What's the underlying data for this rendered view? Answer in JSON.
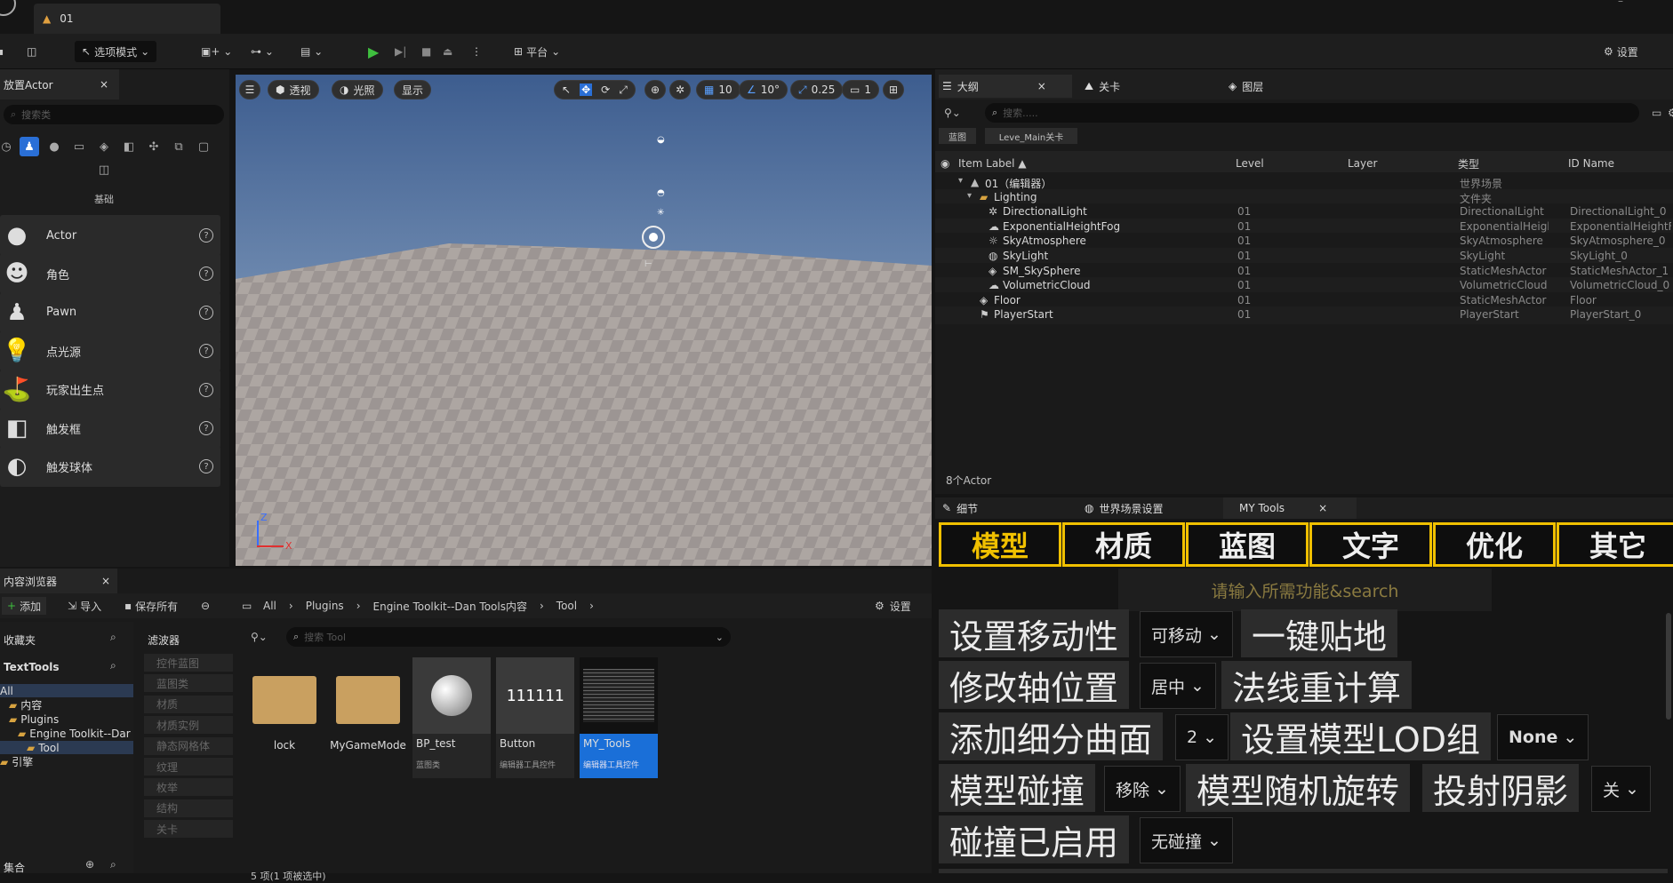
{
  "titlebar": {
    "doc_tab": "01"
  },
  "toolbar": {
    "mode": "选项模式",
    "platform": "平台",
    "settings": "设置"
  },
  "place_actor": {
    "tab": "放置Actor",
    "search_placeholder": "搜索类",
    "category": "基础",
    "items": [
      {
        "label": "Actor",
        "icon": "sphere-icon"
      },
      {
        "label": "角色",
        "icon": "character-icon"
      },
      {
        "label": "Pawn",
        "icon": "pawn-icon"
      },
      {
        "label": "点光源",
        "icon": "point-light-icon"
      },
      {
        "label": "玩家出生点",
        "icon": "player-start-icon"
      },
      {
        "label": "触发框",
        "icon": "trigger-box-icon"
      },
      {
        "label": "触发球体",
        "icon": "trigger-sphere-icon"
      }
    ]
  },
  "viewport": {
    "menu": "☰",
    "perspective": "透视",
    "lighting": "光照",
    "show": "显示",
    "grid": "10",
    "angle": "10°",
    "scale": "0.25",
    "camera_speed": "1",
    "axis_z": "Z",
    "axis_x": "X"
  },
  "outliner": {
    "tabs": [
      "大纲",
      "关卡",
      "图层"
    ],
    "search_placeholder": "搜索.....",
    "chips": [
      "蓝图",
      "Leve_Main关卡"
    ],
    "columns": [
      "Item Label ▲",
      "Level",
      "Layer",
      "类型",
      "ID Name"
    ],
    "rows": [
      {
        "label": "01（编辑器）",
        "level": "",
        "type": "世界场景",
        "id": "",
        "indent": 0
      },
      {
        "label": "Lighting",
        "level": "",
        "type": "文件夹",
        "id": "",
        "indent": 1
      },
      {
        "label": "DirectionalLight",
        "level": "01",
        "type": "DirectionalLight",
        "id": "DirectionalLight_0",
        "indent": 2
      },
      {
        "label": "ExponentialHeightFog",
        "level": "01",
        "type": "ExponentialHeightFo",
        "id": "ExponentialHeightF",
        "indent": 2
      },
      {
        "label": "SkyAtmosphere",
        "level": "01",
        "type": "SkyAtmosphere",
        "id": "SkyAtmosphere_0",
        "indent": 2
      },
      {
        "label": "SkyLight",
        "level": "01",
        "type": "SkyLight",
        "id": "SkyLight_0",
        "indent": 2
      },
      {
        "label": "SM_SkySphere",
        "level": "01",
        "type": "StaticMeshActor",
        "id": "StaticMeshActor_1",
        "indent": 2
      },
      {
        "label": "VolumetricCloud",
        "level": "01",
        "type": "VolumetricCloud",
        "id": "VolumetricCloud_0",
        "indent": 2
      },
      {
        "label": "Floor",
        "level": "01",
        "type": "StaticMeshActor",
        "id": "Floor",
        "indent": 1
      },
      {
        "label": "PlayerStart",
        "level": "01",
        "type": "PlayerStart",
        "id": "PlayerStart_0",
        "indent": 1
      }
    ],
    "count": "8个Actor"
  },
  "tools": {
    "tabs": [
      "细节",
      "世界场景设置",
      "MY Tools"
    ],
    "mode_tabs": [
      "模型",
      "材质",
      "蓝图",
      "文字",
      "优化",
      "其它"
    ],
    "search_placeholder": "请输入所需功能&search",
    "buttons": {
      "mobility": "设置移动性",
      "snap": "一键贴地",
      "pivot": "修改轴位置",
      "normals": "法线重计算",
      "subdiv": "添加细分曲面",
      "lod": "设置模型LOD组",
      "collision": "模型碰撞",
      "rotate": "模型随机旋转",
      "shadow": "投射阴影",
      "collision_enabled": "碰撞已启用"
    },
    "combos": {
      "mobility": "可移动",
      "pivot": "居中",
      "subdiv": "2",
      "lod": "None",
      "collision": "移除",
      "shadow": "关",
      "collision_enabled": "无碰撞"
    },
    "accent": "#f0c000"
  },
  "content_browser": {
    "tab": "内容浏览器",
    "add": "添加",
    "import": "导入",
    "save_all": "保存所有",
    "settings": "设置",
    "path": [
      "All",
      "Plugins",
      "Engine Toolkit--Dan Tools内容",
      "Tool"
    ],
    "favorites": "收藏夹",
    "project": "TextTools",
    "filters": "滤波器",
    "search_placeholder": "搜索 Tool",
    "tree": [
      "All",
      "内容",
      "Plugins",
      "Engine Toolkit--Dar",
      "Tool",
      "引擎"
    ],
    "filter_items": [
      "控件蓝图",
      "蓝图类",
      "材质",
      "材质实例",
      "静态网格体",
      "纹理",
      "枚举",
      "结构",
      "关卡"
    ],
    "collections": "集合",
    "assets": [
      {
        "name": "lock",
        "sub": ""
      },
      {
        "name": "MyGameMode",
        "sub": ""
      },
      {
        "name": "BP_test",
        "sub": "蓝图类"
      },
      {
        "name": "Button",
        "sub": "编辑器工具控件"
      },
      {
        "name": "MY_Tools",
        "sub": "编辑器工具控件"
      }
    ],
    "status": "5 项(1 项被选中)"
  }
}
